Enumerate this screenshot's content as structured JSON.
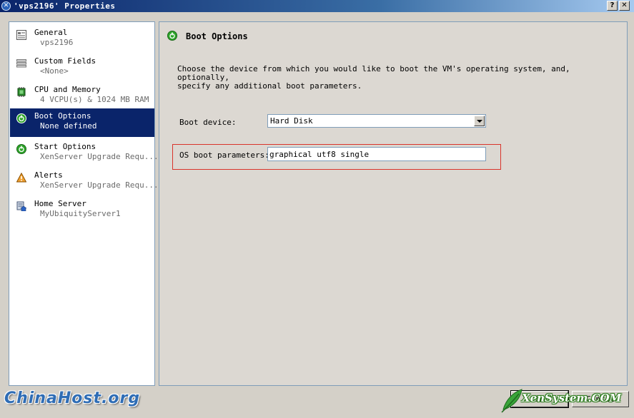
{
  "window": {
    "title": "'vps2196' Properties",
    "help_label": "?",
    "close_label": "✕",
    "app_icon_label": "✕"
  },
  "sidebar": {
    "items": [
      {
        "id": "general",
        "title": "General",
        "subtitle": "vps2196",
        "icon": "general-properties-icon"
      },
      {
        "id": "custom-fields",
        "title": "Custom Fields",
        "subtitle": "<None>",
        "icon": "custom-fields-icon"
      },
      {
        "id": "cpu-memory",
        "title": "CPU and Memory",
        "subtitle": "4 VCPU(s) & 1024 MB RAM",
        "icon": "cpu-chip-icon"
      },
      {
        "id": "boot-options",
        "title": "Boot Options",
        "subtitle": "None defined",
        "icon": "green-power-icon",
        "selected": true
      },
      {
        "id": "start-options",
        "title": "Start Options",
        "subtitle": "XenServer Upgrade Requ...",
        "icon": "green-power-icon"
      },
      {
        "id": "alerts",
        "title": "Alerts",
        "subtitle": "XenServer Upgrade Requ...",
        "icon": "warning-triangle-icon"
      },
      {
        "id": "home-server",
        "title": "Home Server",
        "subtitle": "MyUbiquityServer1",
        "icon": "home-server-icon"
      }
    ]
  },
  "main": {
    "heading": "Boot Options",
    "description": "Choose the device from which you would like to boot the VM's operating system, and, optionally,\nspecify any additional boot parameters.",
    "boot_device": {
      "label": "Boot device:",
      "value": "Hard Disk"
    },
    "os_boot_params": {
      "label": "OS boot parameters:",
      "value": "graphical utf8 single"
    }
  },
  "footer": {
    "ok_label": "OK",
    "cancel_label": "Cancel"
  },
  "watermarks": {
    "left": "ChinaHost.org",
    "right": "XenSystem.COM"
  },
  "colors": {
    "selection": "#0a246a",
    "highlight_box": "#d9342b",
    "power_green": "#2fa52b"
  }
}
